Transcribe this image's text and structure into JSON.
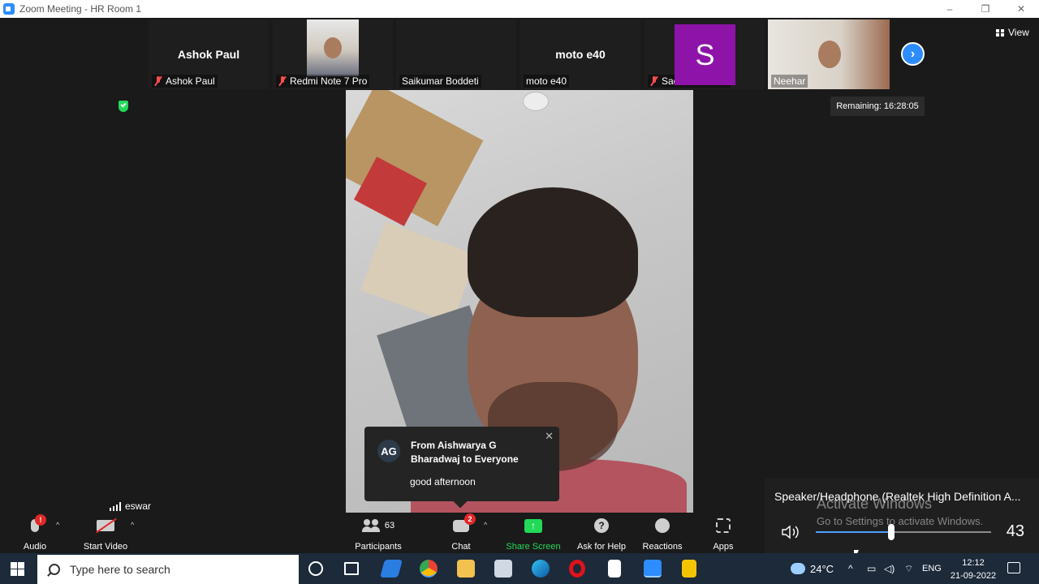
{
  "window": {
    "title": "Zoom Meeting - HR Room 1",
    "controls": [
      "–",
      "❐",
      "✕"
    ]
  },
  "gallery": {
    "tiles": [
      {
        "big_name": "Ashok Paul",
        "label": "Ashok Paul",
        "muted": true
      },
      {
        "big_name": "",
        "label": "Redmi Note 7 Pro",
        "muted": true
      },
      {
        "big_name": "",
        "label": "Saikumar Boddeti",
        "muted": false
      },
      {
        "big_name": "moto e40",
        "label": "moto e40",
        "muted": false
      },
      {
        "big_name": "",
        "label": "Sachin Sharma",
        "muted": true,
        "avatar_letter": "S",
        "avatar_color": "#8e13a8"
      },
      {
        "big_name": "",
        "label": "Neehar",
        "muted": false
      }
    ],
    "view_label": "View",
    "next_icon": "chevron-right-icon"
  },
  "remaining": "Remaining: 16:28:05",
  "speaker_label": "eswar",
  "chat_popup": {
    "avatar": "AG",
    "from": "From Aishwarya G Bharadwaj to Everyone",
    "message": "good afternoon",
    "close": "✕"
  },
  "toolbar": {
    "audio": "Audio",
    "start_video": "Start Video",
    "participants": "Participants",
    "participants_count": "63",
    "chat": "Chat",
    "chat_badge": "2",
    "share_screen": "Share Screen",
    "ask_for_help": "Ask for Help",
    "reactions": "Reactions",
    "apps": "Apps",
    "audio_badge": "!"
  },
  "volume_flyout": {
    "device": "Speaker/Headphone (Realtek High Definition A...",
    "level": "43",
    "level_fraction": 0.43,
    "watermark_title": "Activate Windows",
    "watermark_sub": "Go to Settings to activate Windows."
  },
  "taskbar": {
    "search_placeholder": "Type here to search",
    "weather": "24°C",
    "language": "ENG",
    "time": "12:12",
    "date": "21-09-2022"
  },
  "colors": {
    "zoom_blue": "#2d8cff",
    "share_green": "#23d959",
    "mute_red": "#ff4d4d"
  }
}
